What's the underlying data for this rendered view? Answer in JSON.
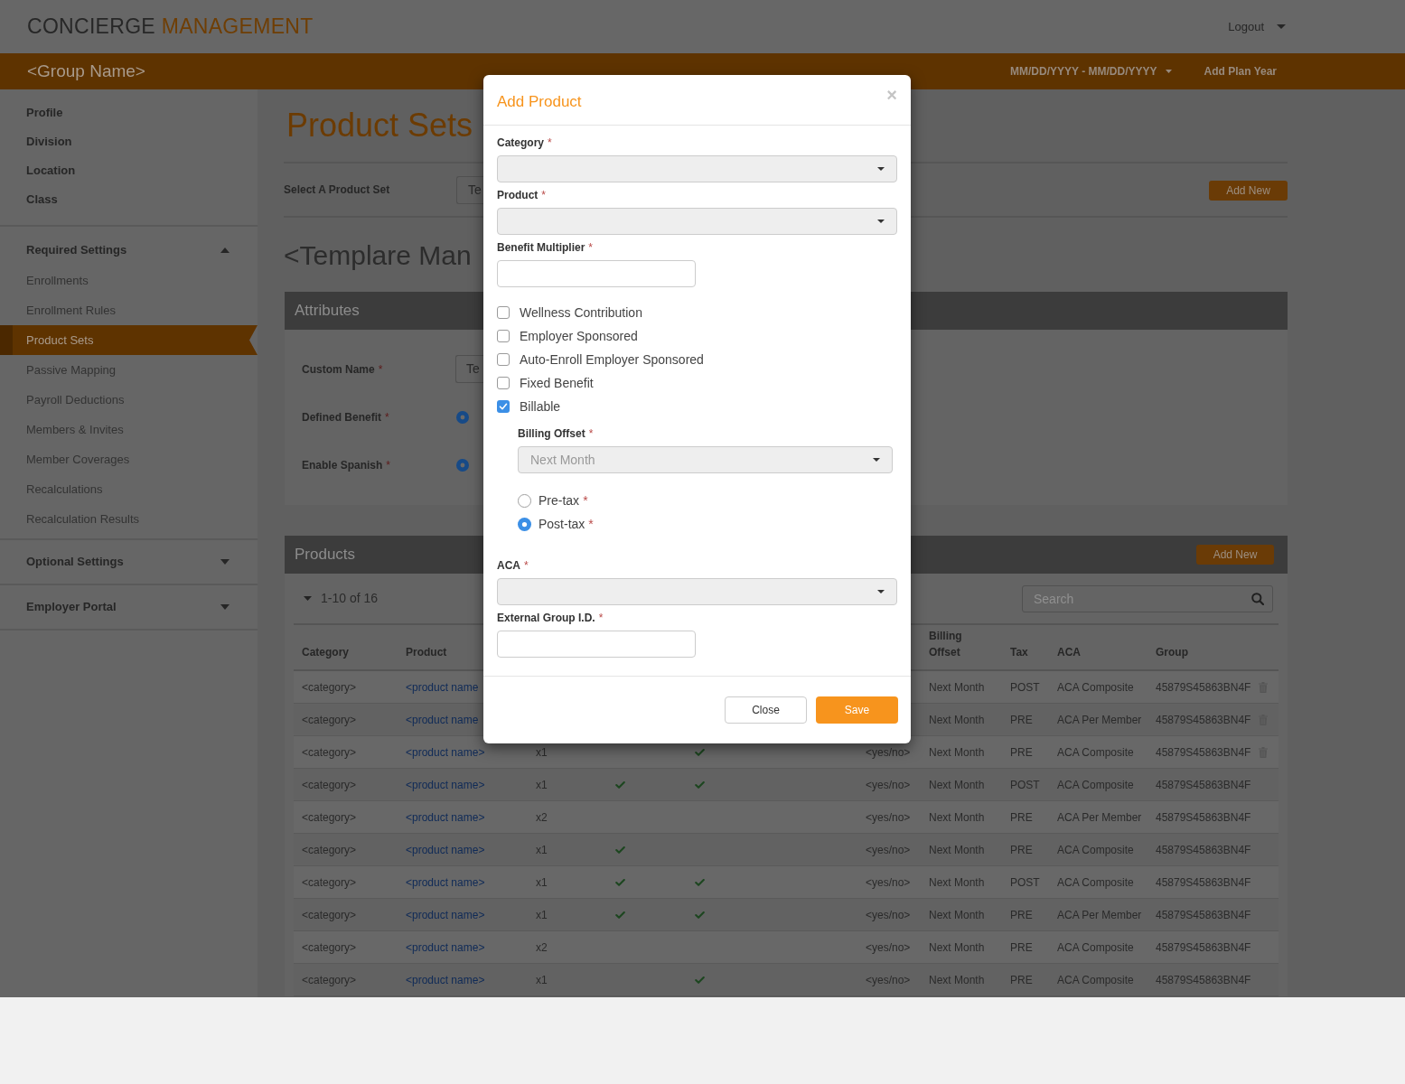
{
  "header": {
    "brand_primary": "CONCIERGE",
    "brand_accent": "MANAGEMENT",
    "user_menu": "Logout"
  },
  "group_bar": {
    "group_name": "<Group Name>",
    "plan_year": "MM/DD/YYYY - MM/DD/YYYY",
    "add_plan_year": "Add Plan Year"
  },
  "sidebar": {
    "items": [
      {
        "label": "Profile"
      },
      {
        "label": "Division"
      },
      {
        "label": "Location"
      },
      {
        "label": "Class"
      }
    ],
    "sections": [
      {
        "label": "Required Settings",
        "expanded": true,
        "children": [
          {
            "label": "Enrollments",
            "selected": false
          },
          {
            "label": "Enrollment Rules",
            "selected": false
          },
          {
            "label": "Product Sets",
            "selected": true
          },
          {
            "label": "Passive Mapping",
            "selected": false
          },
          {
            "label": "Payroll Deductions",
            "selected": false
          },
          {
            "label": "Members & Invites",
            "selected": false
          },
          {
            "label": "Member Coverages",
            "selected": false
          },
          {
            "label": "Recalculations",
            "selected": false
          },
          {
            "label": "Recalculation Results",
            "selected": false
          }
        ]
      },
      {
        "label": "Optional Settings",
        "expanded": false
      },
      {
        "label": "Employer Portal",
        "expanded": false
      }
    ]
  },
  "page": {
    "title": "Product Sets",
    "product_set": {
      "label": "Select A Product Set",
      "value": "Te"
    },
    "add_new": "Add New",
    "template_name": "<Templare Man"
  },
  "attributes": {
    "title": "Attributes",
    "fields": [
      {
        "kind": "text",
        "label": "Custom Name",
        "mark": "*",
        "value": "Te"
      },
      {
        "kind": "radio",
        "label": "Defined Benefit",
        "mark": "*",
        "selected": true
      },
      {
        "kind": "radio",
        "label": "Enable Spanish",
        "mark": "*",
        "selected": true
      }
    ]
  },
  "products": {
    "title": "Products",
    "add_new": "Add New",
    "range": "1-10 of 16",
    "search": {
      "placeholder": "Search"
    },
    "table": {
      "columns": [
        "Category",
        "Product",
        "Billing Offset",
        "Tax",
        "ACA",
        "Group"
      ],
      "rows": [
        {
          "category": "<category>",
          "product": "<product name",
          "billing_offset": "Next Month",
          "tax": "POST",
          "aca": "ACA Composite",
          "group": "45879S45863BN4F",
          "deletable": true
        },
        {
          "category": "<category>",
          "product": "<product name",
          "billing_offset": "Next Month",
          "tax": "PRE",
          "aca": "ACA Per Member",
          "group": "45879S45863BN4F",
          "deletable": true
        },
        {
          "category": "<category>",
          "product": "<product name>",
          "column_3": "x1",
          "column_4": false,
          "column_5": true,
          "column_6": "<yes/no>",
          "billing_offset": "Next Month",
          "tax": "PRE",
          "aca": "ACA Composite",
          "group": "45879S45863BN4F",
          "deletable": true
        },
        {
          "category": "<category>",
          "product": "<product name>",
          "column_3": "x1",
          "column_4": true,
          "column_5": true,
          "column_6": "<yes/no>",
          "billing_offset": "Next Month",
          "tax": "POST",
          "aca": "ACA Composite",
          "group": "45879S45863BN4F",
          "deletable": false
        },
        {
          "category": "<category>",
          "product": "<product name>",
          "column_3": "x2",
          "column_4": false,
          "column_5": false,
          "column_6": "<yes/no>",
          "billing_offset": "Next Month",
          "tax": "PRE",
          "aca": "ACA Per Member",
          "group": "45879S45863BN4F",
          "deletable": false
        },
        {
          "category": "<category>",
          "product": "<product name>",
          "column_3": "x1",
          "column_4": true,
          "column_5": false,
          "column_6": "<yes/no>",
          "billing_offset": "Next Month",
          "tax": "PRE",
          "aca": "ACA Composite",
          "group": "45879S45863BN4F",
          "deletable": false
        },
        {
          "category": "<category>",
          "product": "<product name>",
          "column_3": "x1",
          "column_4": true,
          "column_5": true,
          "column_6": "<yes/no>",
          "billing_offset": "Next Month",
          "tax": "POST",
          "aca": "ACA Composite",
          "group": "45879S45863BN4F",
          "deletable": false
        },
        {
          "category": "<category>",
          "product": "<product name>",
          "column_3": "x1",
          "column_4": true,
          "column_5": true,
          "column_6": "<yes/no>",
          "billing_offset": "Next Month",
          "tax": "PRE",
          "aca": "ACA Per Member",
          "group": "45879S45863BN4F",
          "deletable": false
        },
        {
          "category": "<category>",
          "product": "<product name>",
          "column_3": "x2",
          "column_4": false,
          "column_5": false,
          "column_6": "<yes/no>",
          "billing_offset": "Next Month",
          "tax": "PRE",
          "aca": "ACA Composite",
          "group": "45879S45863BN4F",
          "deletable": false
        },
        {
          "category": "<category>",
          "product": "<product name>",
          "column_3": "x1",
          "column_4": false,
          "column_5": true,
          "column_6": "<yes/no>",
          "billing_offset": "Next Month",
          "tax": "PRE",
          "aca": "ACA Composite",
          "group": "45879S45863BN4F",
          "deletable": false
        }
      ]
    }
  },
  "modal": {
    "title": "Add Product",
    "close": "×",
    "fields": [
      {
        "kind": "select",
        "label": "Category",
        "mark": "*"
      },
      {
        "kind": "select",
        "label": "Product",
        "mark": "*"
      },
      {
        "kind": "input",
        "label": "Benefit Multiplier",
        "mark": "*"
      },
      {
        "kind": "checkbox",
        "label": "Wellness Contribution",
        "checked": false
      },
      {
        "kind": "checkbox",
        "label": "Employer Sponsored",
        "checked": false
      },
      {
        "kind": "checkbox",
        "label": "Auto-Enroll Employer Sponsored",
        "checked": false
      },
      {
        "kind": "checkbox",
        "label": "Fixed Benefit",
        "checked": false
      },
      {
        "kind": "checkbox",
        "label": "Billable",
        "checked": true,
        "children": [
          {
            "kind": "select",
            "label": "Billing Offset",
            "mark": "*",
            "value": "Next Month"
          },
          {
            "kind": "radio",
            "label": "Pre-tax",
            "mark": "*",
            "selected": false
          },
          {
            "kind": "radio",
            "label": "Post-tax",
            "mark": "*",
            "selected": true
          }
        ]
      },
      {
        "kind": "select",
        "label": "ACA",
        "mark": "*"
      },
      {
        "kind": "input",
        "label": "External Group I.D.",
        "mark": "*"
      }
    ],
    "buttons": [
      {
        "label": "Close",
        "kind": "secondary"
      },
      {
        "label": "Save",
        "kind": "primary"
      }
    ]
  }
}
